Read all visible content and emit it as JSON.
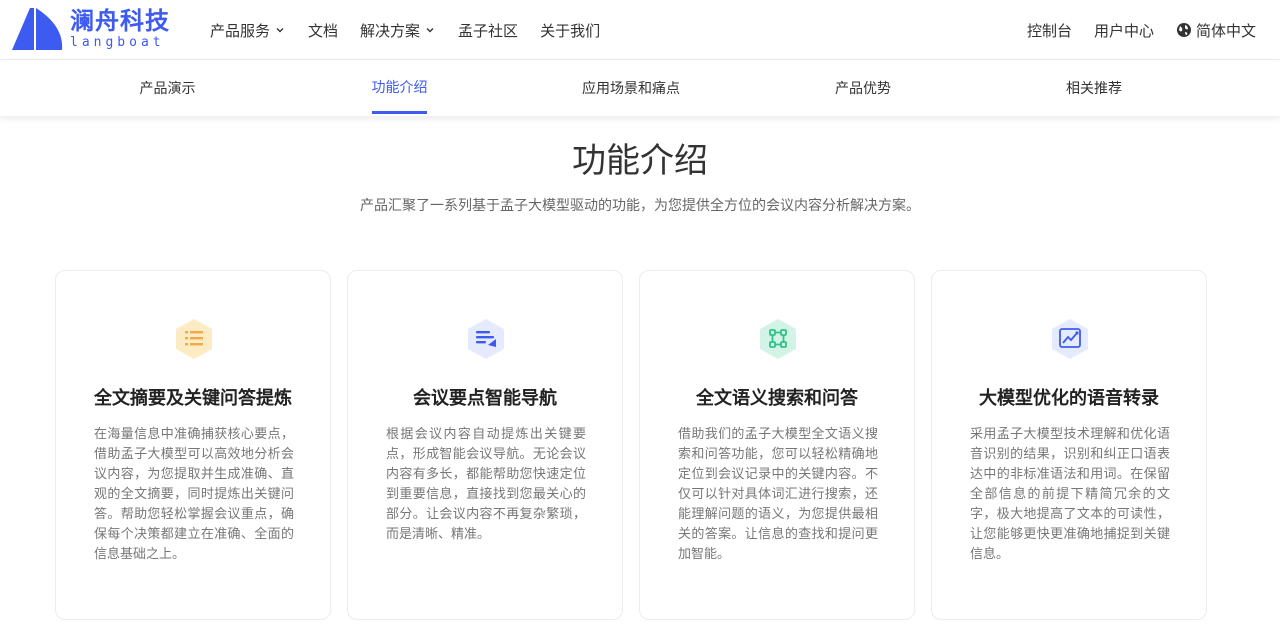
{
  "header": {
    "logo_cn": "澜舟科技",
    "logo_en": "langboat",
    "nav": [
      {
        "label": "产品服务",
        "has_dropdown": true
      },
      {
        "label": "文档",
        "has_dropdown": false
      },
      {
        "label": "解决方案",
        "has_dropdown": true
      },
      {
        "label": "孟子社区",
        "has_dropdown": false
      },
      {
        "label": "关于我们",
        "has_dropdown": false
      }
    ],
    "right": {
      "console": "控制台",
      "user_center": "用户中心",
      "language": "简体中文"
    }
  },
  "subnav": {
    "tabs": [
      {
        "label": "产品演示"
      },
      {
        "label": "功能介绍",
        "active": true
      },
      {
        "label": "应用场景和痛点"
      },
      {
        "label": "产品优势"
      },
      {
        "label": "相关推荐"
      }
    ]
  },
  "section": {
    "title": "功能介绍",
    "subtitle": "产品汇聚了一系列基于孟子大模型驱动的功能，为您提供全方位的会议内容分析解决方案。"
  },
  "cards": [
    {
      "icon": "summary-list-icon",
      "color": "#f7c35f",
      "title": "全文摘要及关键问答提炼",
      "desc": "在海量信息中准确捕获核心要点，借助孟子大模型可以高效地分析会议内容，为您提取并生成准确、直观的全文摘要，同时提炼出关键问答。帮助您轻松掌握会议重点，确保每个决策都建立在准确、全面的信息基础之上。"
    },
    {
      "icon": "smart-navigation-icon",
      "color": "#3d5af1",
      "title": "会议要点智能导航",
      "desc": "根据会议内容自动提炼出关键要点，形成智能会议导航。无论会议内容有多长，都能帮助您快速定位到重要信息，直接找到您最关心的部分。让会议内容不再复杂繁琐，而是清晰、精准。"
    },
    {
      "icon": "semantic-search-icon",
      "color": "#2fc28a",
      "title": "全文语义搜索和问答",
      "desc": "借助我们的孟子大模型全文语义搜索和问答功能，您可以轻松精确地定位到会议记录中的关键内容。不仅可以针对具体词汇进行搜索，还能理解问题的语义，为您提供最相关的答案。让信息的查找和提问更加智能。"
    },
    {
      "icon": "speech-transcription-icon",
      "color": "#3d5af1",
      "title": "大模型优化的语音转录",
      "desc": "采用孟子大模型技术理解和优化语音识别的结果，识别和纠正口语表达中的非标准语法和用词。在保留全部信息的前提下精简冗余的文字，极大地提高了文本的可读性，让您能够更快更准确地捕捉到关键信息。"
    }
  ]
}
